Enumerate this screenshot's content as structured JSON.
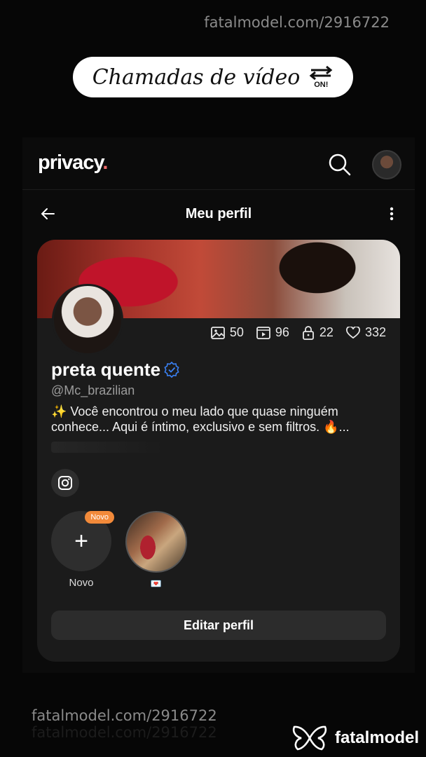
{
  "watermark": {
    "top": "fatalmodel.com/2916722",
    "bottom": "fatalmodel.com/2916722",
    "brand": "fatalmodel"
  },
  "promo": {
    "text": "Chamadas de vídeo",
    "badge": "ON!"
  },
  "app": {
    "logo_text": "privacy",
    "logo_dot": ".",
    "logo_dot_color": "#f26d6d"
  },
  "subbar": {
    "title": "Meu perfil"
  },
  "profile": {
    "stats": {
      "photos": "50",
      "videos": "96",
      "locked": "22",
      "likes": "332"
    },
    "name": "preta quente",
    "handle": "@Mc_brazilian",
    "bio": "✨ Você encontrou o meu lado que quase ninguém conhece... Aqui é íntimo, exclusivo e sem filtros. 🔥...",
    "highlights": {
      "new_label": "Novo",
      "new_badge": "Novo",
      "story_label": "💌"
    },
    "edit_button": "Editar perfil"
  },
  "colors": {
    "accent": "#f28a3a",
    "verified": "#3b82f6"
  },
  "icons": [
    "search-icon",
    "back-arrow-icon",
    "more-vertical-icon",
    "image-icon",
    "video-icon",
    "lock-icon",
    "heart-icon",
    "verified-badge-icon",
    "instagram-icon",
    "plus-icon",
    "fatalmodel-logo-icon",
    "swap-arrows-icon"
  ]
}
